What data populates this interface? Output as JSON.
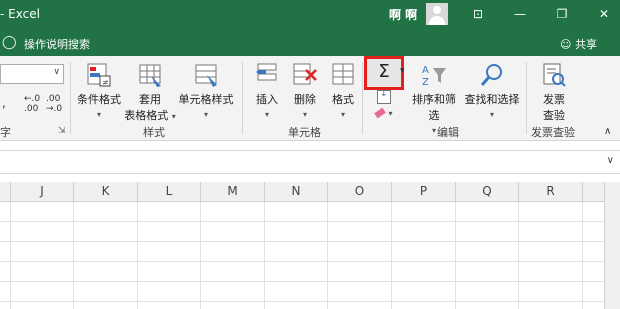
{
  "titlebar": {
    "title": "- Excel",
    "user": "啊 啊",
    "buttons": {
      "ribbon_display": "⊡",
      "minimize": "—",
      "restore": "❐",
      "close": "✕"
    }
  },
  "tellbar": {
    "tell_me": "操作说明搜索",
    "share": "共享"
  },
  "ribbon": {
    "number": {
      "comma": ",",
      "inc_decimal": "←.0\n.00",
      "dec_decimal": ".00\n→.0",
      "group_fragment": "字"
    },
    "styles": {
      "conditional": "条件格式",
      "table_line1": "套用",
      "table_line2": "表格格式",
      "cell_styles": "单元格样式",
      "group": "样式"
    },
    "cells": {
      "insert": "插入",
      "delete": "删除",
      "format": "格式",
      "group": "单元格"
    },
    "editing": {
      "sigma": "Σ",
      "sort": "排序和筛选",
      "find": "查找和选择",
      "group": "编辑"
    },
    "invoice": {
      "line1": "发票",
      "line2": "查验",
      "group": "发票查验"
    }
  },
  "columns": [
    "J",
    "K",
    "L",
    "M",
    "N",
    "O",
    "P",
    "Q",
    "R"
  ],
  "colors": {
    "excel_green": "#217346",
    "highlight_red": "#e3201b"
  }
}
